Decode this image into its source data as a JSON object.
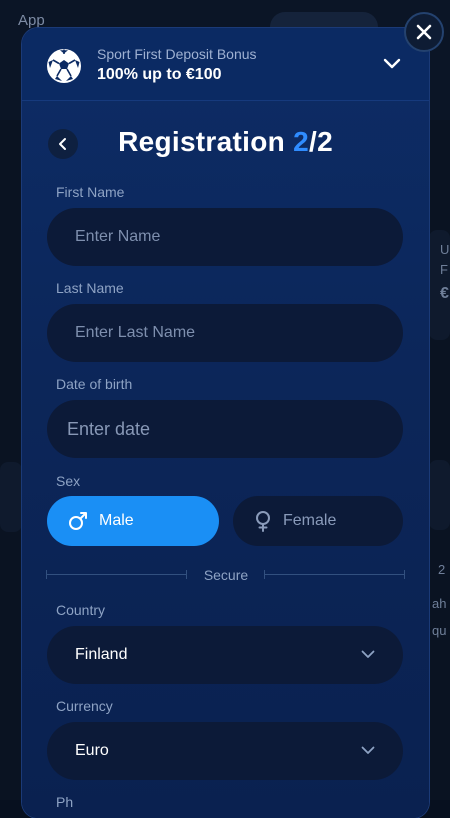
{
  "background": {
    "app_label": "App",
    "fragments": [
      "U",
      "F",
      "€",
      "ah",
      "qu",
      "2"
    ]
  },
  "banner": {
    "subtitle": "Sport First Deposit Bonus",
    "title": "100% up to €100",
    "icon": "soccer-ball-icon"
  },
  "header": {
    "title": "Registration",
    "step_current": "2",
    "step_total": "/2"
  },
  "form": {
    "first_name": {
      "label": "First Name",
      "placeholder": "Enter Name"
    },
    "last_name": {
      "label": "Last Name",
      "placeholder": "Enter Last Name"
    },
    "dob": {
      "label": "Date of birth",
      "placeholder": "Enter date"
    },
    "sex": {
      "label": "Sex",
      "male": "Male",
      "female": "Female",
      "selected": "male"
    },
    "divider_label": "Secure",
    "country": {
      "label": "Country",
      "value": "Finland"
    },
    "currency": {
      "label": "Currency",
      "value": "Euro"
    },
    "next_label_partial": "Ph"
  },
  "colors": {
    "accent": "#1a8ff5",
    "step_highlight": "#2f8cff",
    "modal_bg": "#0c2659",
    "field_bg": "#0c1a38"
  }
}
